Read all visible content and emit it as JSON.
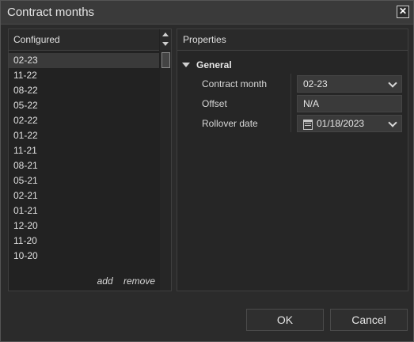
{
  "window": {
    "title": "Contract months",
    "close_icon": "close-icon"
  },
  "left_panel": {
    "header": "Configured",
    "items": [
      "02-23",
      "11-22",
      "08-22",
      "05-22",
      "02-22",
      "01-22",
      "11-21",
      "08-21",
      "05-21",
      "02-21",
      "01-21",
      "12-20",
      "11-20",
      "10-20"
    ],
    "selected_index": 0,
    "actions": {
      "add": "add",
      "remove": "remove"
    }
  },
  "right_panel": {
    "header": "Properties",
    "group": "General",
    "properties": [
      {
        "label": "Contract month",
        "value": "02-23",
        "kind": "dropdown"
      },
      {
        "label": "Offset",
        "value": "N/A",
        "kind": "text"
      },
      {
        "label": "Rollover date",
        "value": "01/18/2023",
        "kind": "date-dropdown"
      }
    ]
  },
  "buttons": {
    "ok": "OK",
    "cancel": "Cancel"
  }
}
